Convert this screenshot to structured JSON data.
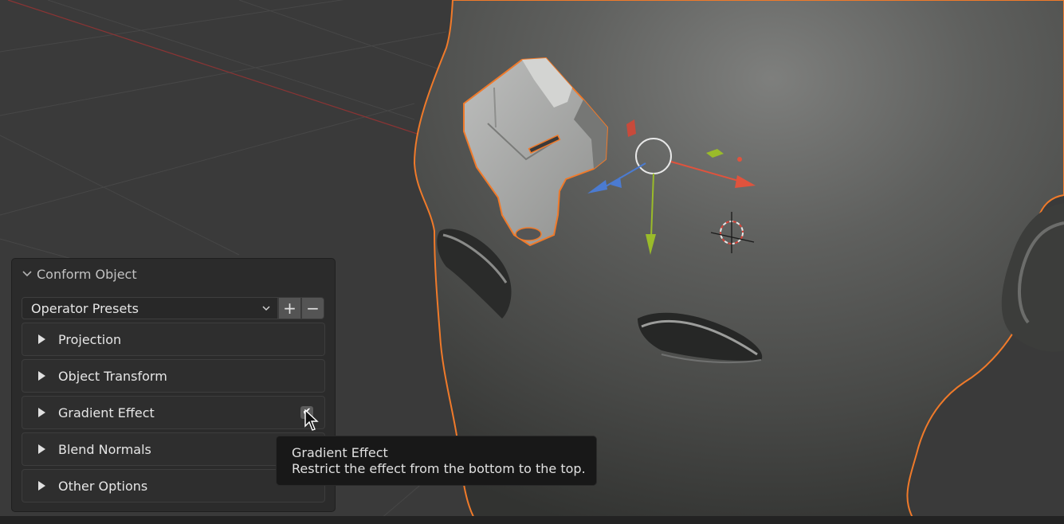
{
  "colors": {
    "selection_outline": "#f07a2a",
    "axis_x": "#e0533d",
    "axis_y": "#9abb2a",
    "axis_z": "#4b7bd1",
    "panel_bg": "#2b2b2b",
    "tooltip_bg": "#181818"
  },
  "viewport": {
    "objects": [
      "head-mesh",
      "conform-object-mesh",
      "transform-gizmo",
      "3d-cursor"
    ]
  },
  "panel": {
    "title": "Conform Object",
    "collapse_icon": "chevron-down-icon",
    "presets": {
      "value": "Operator Presets",
      "add_label": "+",
      "remove_label": "−"
    },
    "sections": [
      {
        "label": "Projection",
        "icon": "disclosure-triangle-icon"
      },
      {
        "label": "Object Transform",
        "icon": "disclosure-triangle-icon"
      },
      {
        "label": "Gradient Effect",
        "icon": "disclosure-triangle-icon",
        "checkbox_checked": true
      },
      {
        "label": "Blend Normals",
        "icon": "disclosure-triangle-icon"
      },
      {
        "label": "Other Options",
        "icon": "disclosure-triangle-icon"
      }
    ]
  },
  "tooltip": {
    "title": "Gradient Effect",
    "description": "Restrict the effect from the bottom to the top."
  }
}
